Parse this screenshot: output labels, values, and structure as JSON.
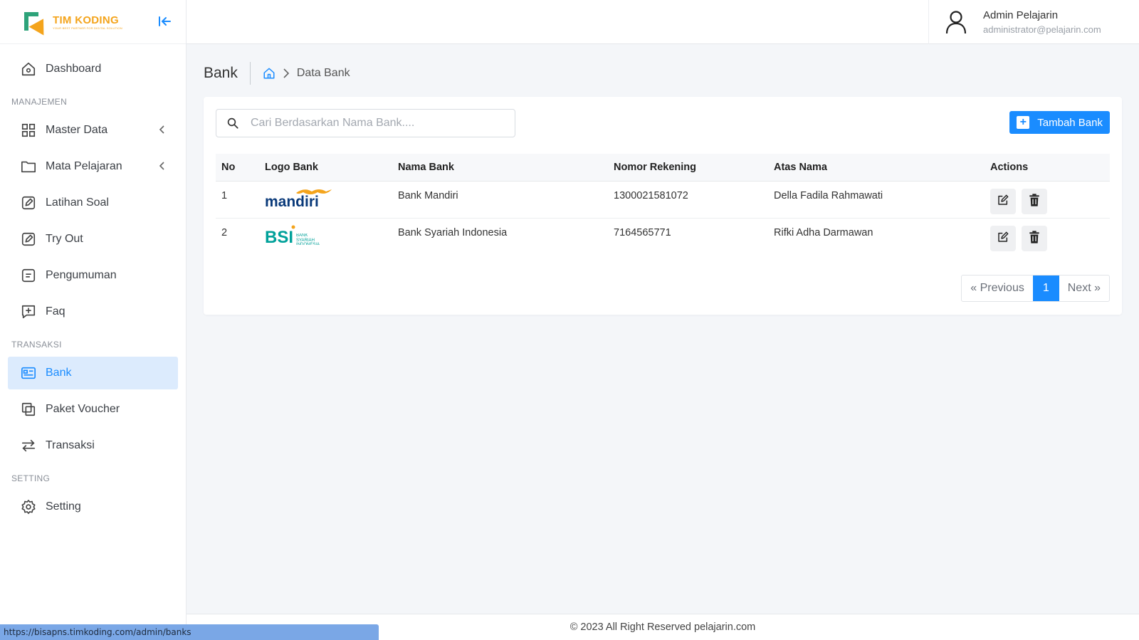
{
  "brand": {
    "name": "TIM KODING",
    "tagline": "YOUR BEST PARTNER FOR DIGITAL SOLUTION"
  },
  "sidebar": {
    "items": [
      {
        "label": "Dashboard",
        "icon": "home-icon"
      },
      {
        "section": "MANAJEMEN"
      },
      {
        "label": "Master Data",
        "icon": "grid-icon"
      },
      {
        "label": "Mata Pelajaran",
        "icon": "folder-icon"
      },
      {
        "label": "Latihan Soal",
        "icon": "edit-icon"
      },
      {
        "label": "Try Out",
        "icon": "edit-icon"
      },
      {
        "label": "Pengumuman",
        "icon": "note-icon"
      },
      {
        "label": "Faq",
        "icon": "chat-plus-icon"
      },
      {
        "section": "TRANSAKSI"
      },
      {
        "label": "Bank",
        "icon": "card-icon"
      },
      {
        "label": "Paket Voucher",
        "icon": "copy-icon"
      },
      {
        "label": "Transaksi",
        "icon": "swap-icon"
      },
      {
        "section": "SETTING"
      },
      {
        "label": "Setting",
        "icon": "gear-icon"
      }
    ]
  },
  "user": {
    "name": "Admin Pelajarin",
    "email": "administrator@pelajarin.com"
  },
  "page": {
    "title": "Bank",
    "breadcrumb": "Data Bank"
  },
  "search": {
    "placeholder": "Cari Berdasarkan Nama Bank....",
    "value": ""
  },
  "toolbar": {
    "add_label": "Tambah Bank"
  },
  "table": {
    "headers": [
      "No",
      "Logo Bank",
      "Nama Bank",
      "Nomor Rekening",
      "Atas Nama",
      "Actions"
    ],
    "rows": [
      {
        "no": "1",
        "logo": "mandiri",
        "nama": "Bank Mandiri",
        "rekening": "1300021581072",
        "atas_nama": "Della Fadila Rahmawati"
      },
      {
        "no": "2",
        "logo": "BSI",
        "logo_sub": "BANK SYARIAH INDONESIA",
        "nama": "Bank Syariah Indonesia",
        "rekening": "7164565771",
        "atas_nama": "Rifki Adha Darmawan"
      }
    ]
  },
  "pagination": {
    "prev": "« Previous",
    "current": "1",
    "next": "Next »"
  },
  "footer": {
    "text": "© 2023 All Right Reserved pelajarin.com"
  },
  "status_bar": {
    "url": "https://bisapns.timkoding.com/admin/banks"
  },
  "colors": {
    "accent": "#1a8cff",
    "active_bg": "#dcebfd",
    "brand_orange": "#f4a41c",
    "brand_green": "#2ea37a",
    "mandiri_blue": "#0a3a7a",
    "bsi_teal": "#00a19a"
  }
}
